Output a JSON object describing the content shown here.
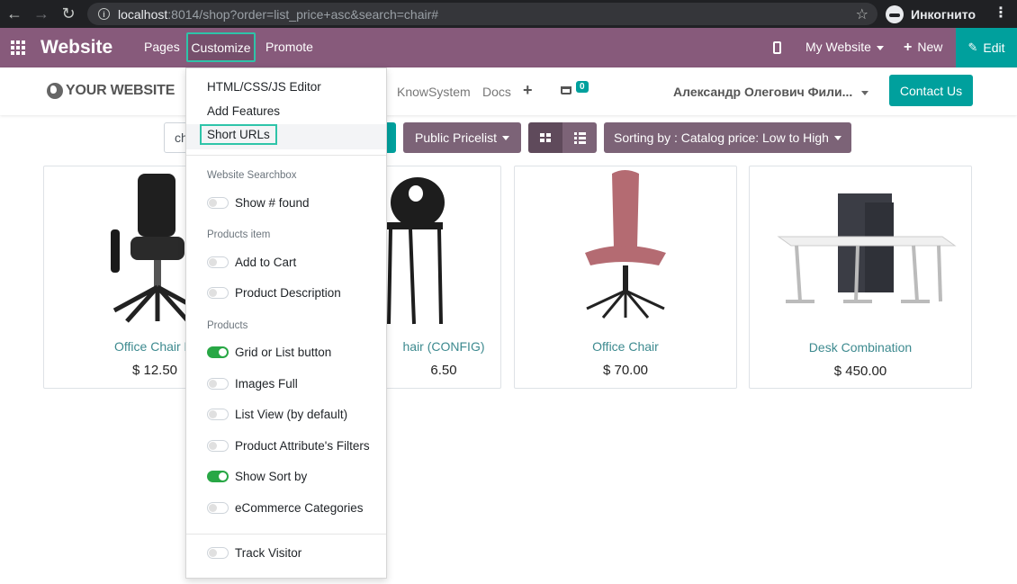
{
  "browser": {
    "url_host": "localhost",
    "url_rest": ":8014/shop?order=list_price+asc&search=chair#",
    "incognito_label": "Инкогнито"
  },
  "topbar": {
    "brand": "Website",
    "menus": [
      "Pages",
      "Customize",
      "Promote"
    ],
    "my_website": "My Website",
    "new_label": "New",
    "edit_label": "Edit",
    "bg_color": "#875a7b",
    "accent_color": "#00a09d"
  },
  "site_header": {
    "logo": "YOUR WEBSITE",
    "nav": [
      "KnowSystem",
      "Docs"
    ],
    "cart_count": "0",
    "user": "Александр Олегович Фили...",
    "contact_label": "Contact Us"
  },
  "toolbar": {
    "search_value": "ch",
    "pricelist": "Public Pricelist",
    "sort": "Sorting by : Catalog price: Low to High"
  },
  "products": [
    {
      "name": "Office Chair Bl",
      "price": "$ 12.50"
    },
    {
      "name": "hair (CONFIG)",
      "price": "6.50"
    },
    {
      "name": "Office Chair",
      "price": "$ 70.00"
    },
    {
      "name": "Desk Combination",
      "price": "$ 450.00"
    }
  ],
  "dropdown": {
    "items": [
      "HTML/CSS/JS Editor",
      "Add Features",
      "Short URLs"
    ],
    "sections": [
      {
        "header": "Website Searchbox",
        "options": [
          {
            "label": "Show # found",
            "on": false
          }
        ]
      },
      {
        "header": "Products item",
        "options": [
          {
            "label": "Add to Cart",
            "on": false
          },
          {
            "label": "Product Description",
            "on": false
          }
        ]
      },
      {
        "header": "Products",
        "options": [
          {
            "label": "Grid or List button",
            "on": true
          },
          {
            "label": "Images Full",
            "on": false
          },
          {
            "label": "List View (by default)",
            "on": false
          },
          {
            "label": "Product Attribute's Filters",
            "on": false
          },
          {
            "label": "Show Sort by",
            "on": true
          },
          {
            "label": "eCommerce Categories",
            "on": false
          }
        ]
      }
    ],
    "footer_option": {
      "label": "Track Visitor",
      "on": false
    }
  }
}
